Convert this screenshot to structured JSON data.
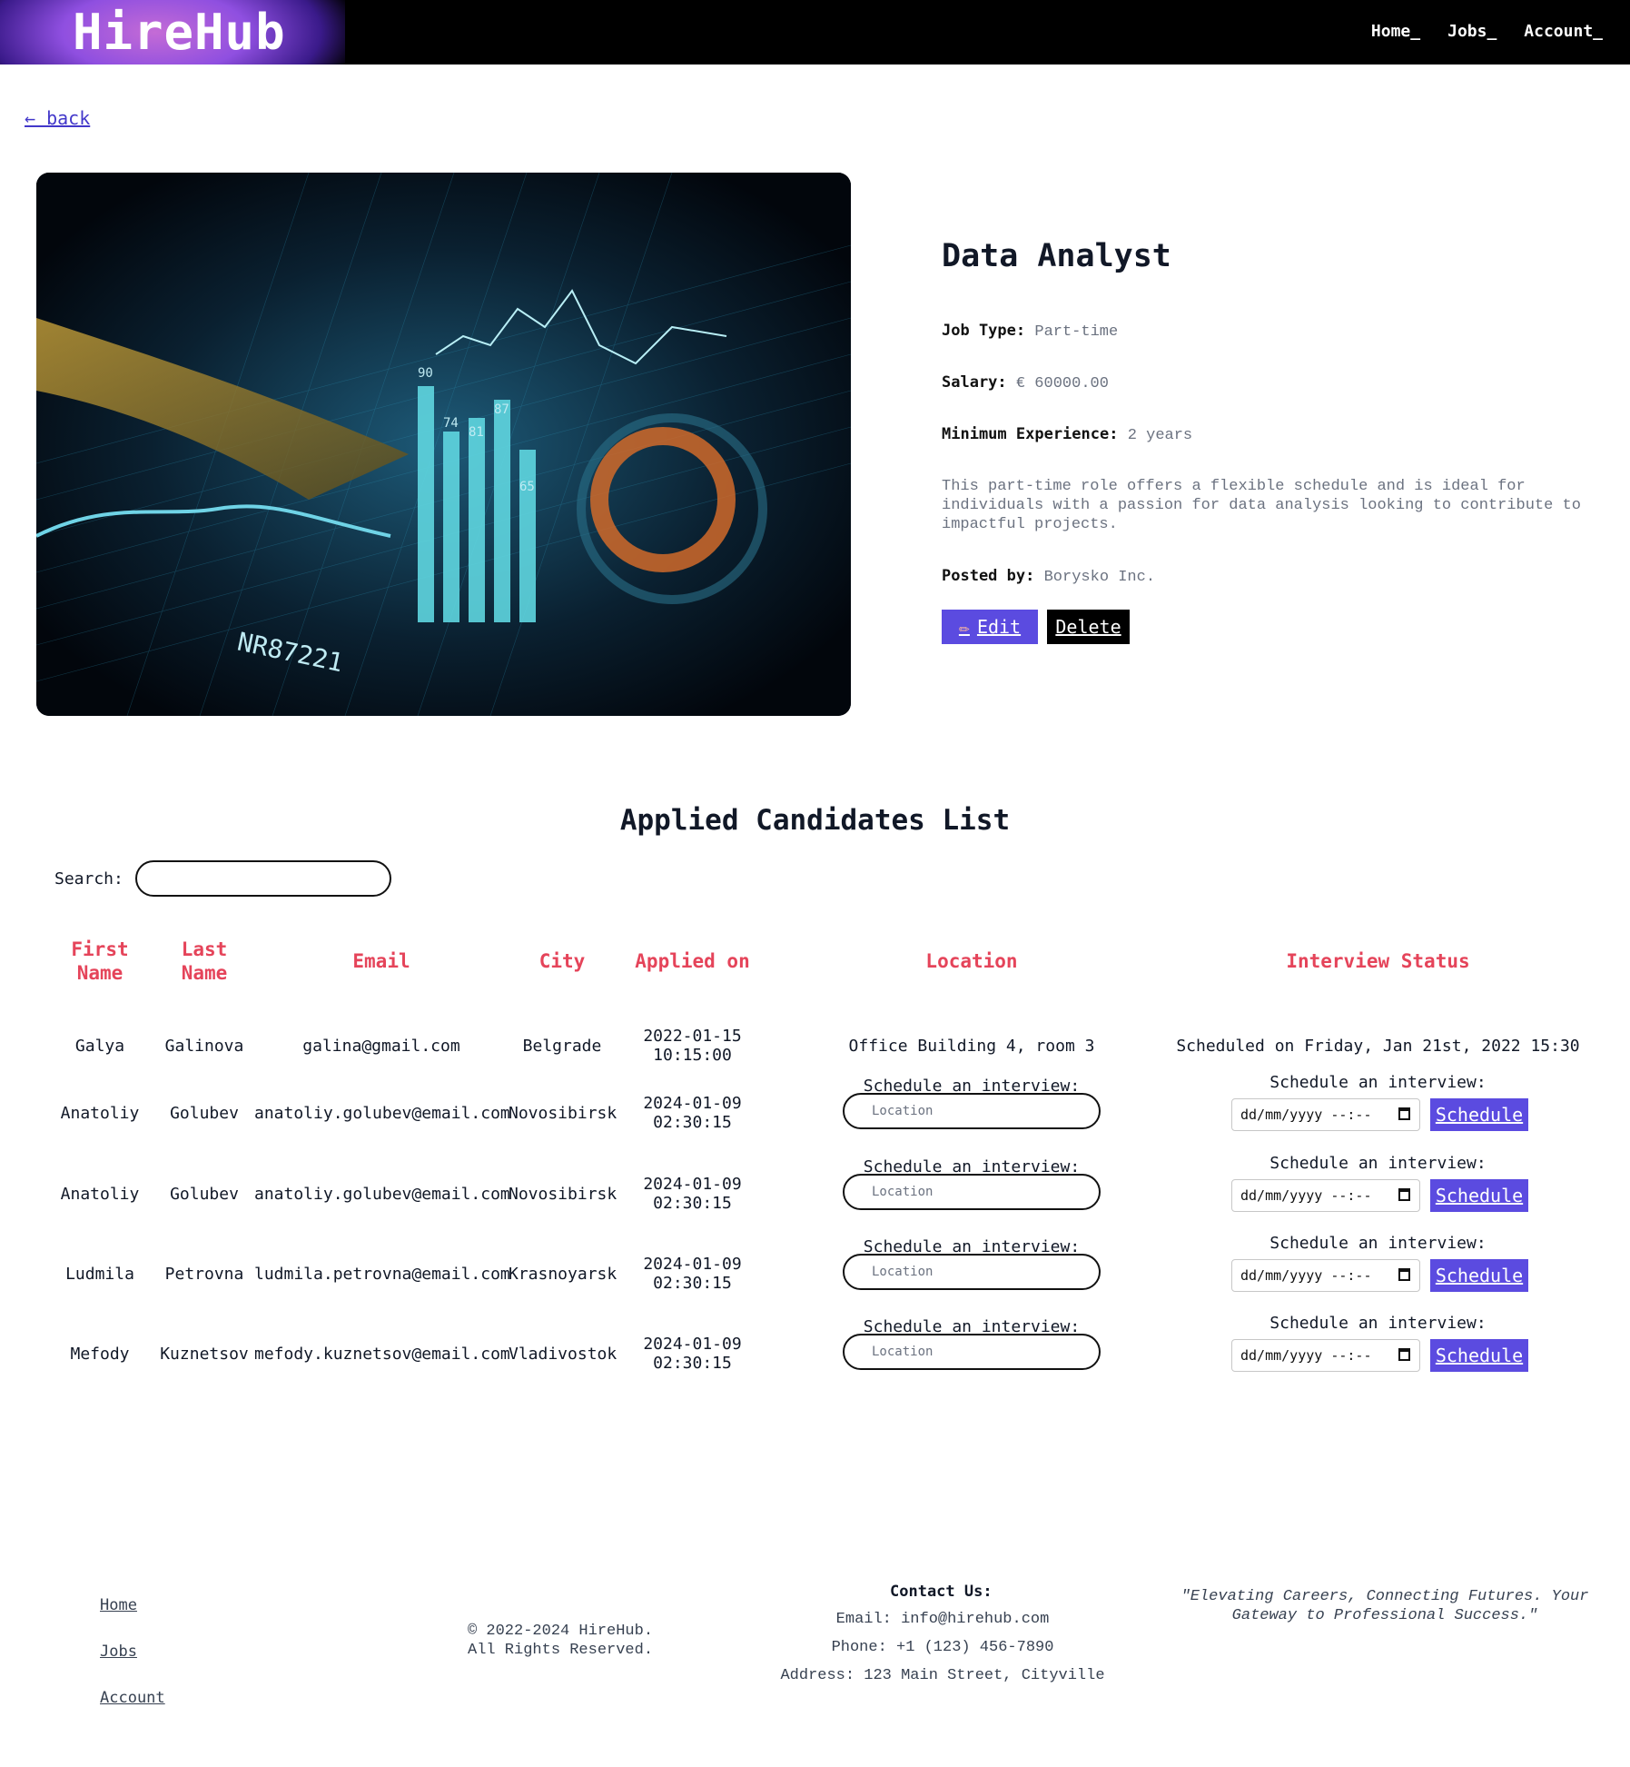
{
  "header": {
    "logo": "HireHub",
    "nav": [
      "Home_",
      "Jobs_",
      "Account_"
    ]
  },
  "back_label": "← back",
  "job": {
    "title": "Data Analyst",
    "job_type_label": "Job Type:",
    "job_type": "Part-time",
    "salary_label": "Salary:",
    "salary": "€ 60000.00",
    "experience_label": "Minimum Experience:",
    "experience": "2 years",
    "description_lines": [
      "This part-time role offers a flexible schedule and is ideal for",
      "individuals with a passion for data analysis looking to contribute to",
      "impactful projects."
    ],
    "posted_label": "Posted by:",
    "posted_by": "Borysko Inc.",
    "edit_label": "Edit",
    "delete_label": "Delete"
  },
  "candidates": {
    "title": "Applied Candidates List",
    "search_label": "Search:",
    "search_value": "",
    "columns": [
      "First Name",
      "Last Name",
      "Email",
      "City",
      "Applied on",
      "Location",
      "Interview Status"
    ],
    "rows": [
      {
        "first": "Galya",
        "last": "Galinova",
        "email": "galina@gmail.com",
        "city": "Belgrade",
        "applied": [
          "2022-01-15",
          "10:15:00"
        ],
        "location": "Office Building 4, room 3",
        "status": "Scheduled on Friday, Jan 21st, 2022 15:30"
      },
      {
        "first": "Anatoliy",
        "last": "Golubev",
        "email": "anatoliy.golubev@email.com",
        "city": "Novosibirsk",
        "applied": [
          "2024-01-09",
          "02:30:15"
        ]
      },
      {
        "first": "Anatoliy",
        "last": "Golubev",
        "email": "anatoliy.golubev@email.com",
        "city": "Novosibirsk",
        "applied": [
          "2024-01-09",
          "02:30:15"
        ]
      },
      {
        "first": "Ludmila",
        "last": "Petrovna",
        "email": "ludmila.petrovna@email.com",
        "city": "Krasnoyarsk",
        "applied": [
          "2024-01-09",
          "02:30:15"
        ]
      },
      {
        "first": "Mefody",
        "last": "Kuznetsov",
        "email": "mefody.kuznetsov@email.com",
        "city": "Vladivostok",
        "applied": [
          "2024-01-09",
          "02:30:15"
        ]
      }
    ],
    "schedule_label": "Schedule an interview:",
    "location_placeholder": "Location",
    "date_placeholder": "dd/mm/yyyy --:--",
    "schedule_button": "Schedule"
  },
  "footer": {
    "links": [
      "Home",
      "Jobs",
      "Account"
    ],
    "copyright": [
      "© 2022-2024 HireHub.",
      "All Rights Reserved."
    ],
    "contact_title": "Contact Us:",
    "email": "Email: info@hirehub.com",
    "phone": "Phone: +1 (123) 456-7890",
    "address": "Address: 123 Main Street, Cityville",
    "quote": "\"Elevating Careers, Connecting Futures. Your Gateway to Professional Success.\""
  },
  "colors": {
    "accent": "#5b4be0",
    "header_red": "#e5445a",
    "link": "#4338ca"
  }
}
